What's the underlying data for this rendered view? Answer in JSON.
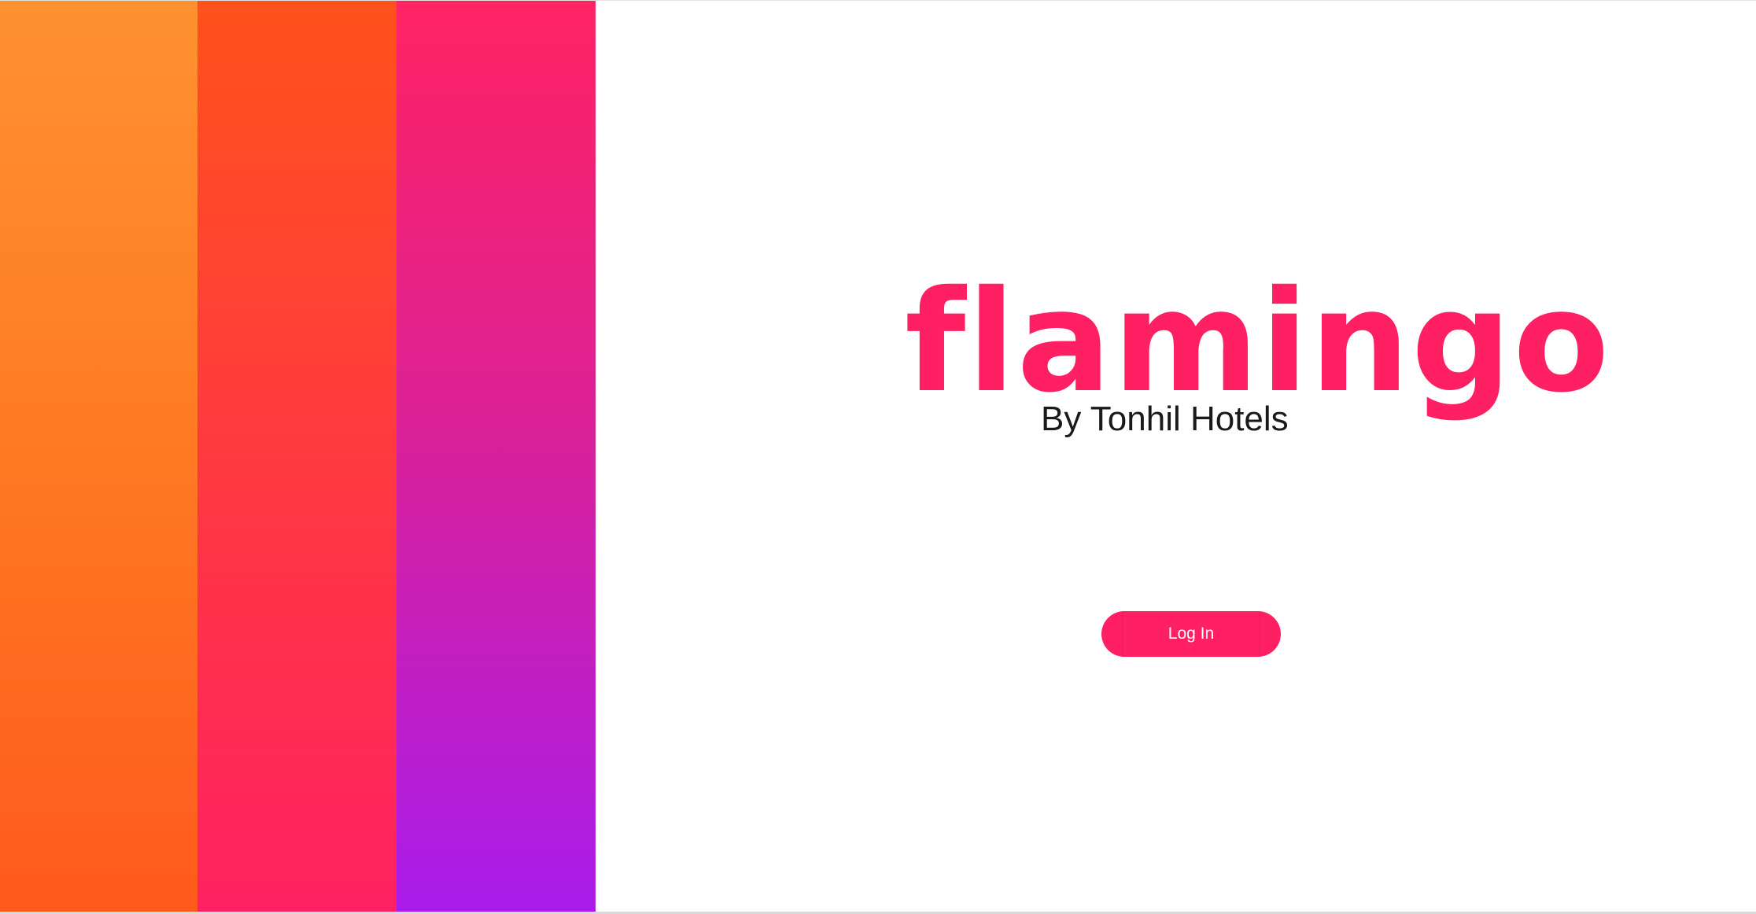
{
  "brand": {
    "name": "flamingo",
    "tagline": "By Tonhil Hotels"
  },
  "actions": {
    "login_label": "Log In"
  },
  "colors": {
    "accent": "#ff1f63",
    "stripe_orange": "#ff8a28",
    "stripe_red": "#ff3c3c",
    "stripe_magenta": "#dc2195",
    "background": "#ffffff"
  }
}
